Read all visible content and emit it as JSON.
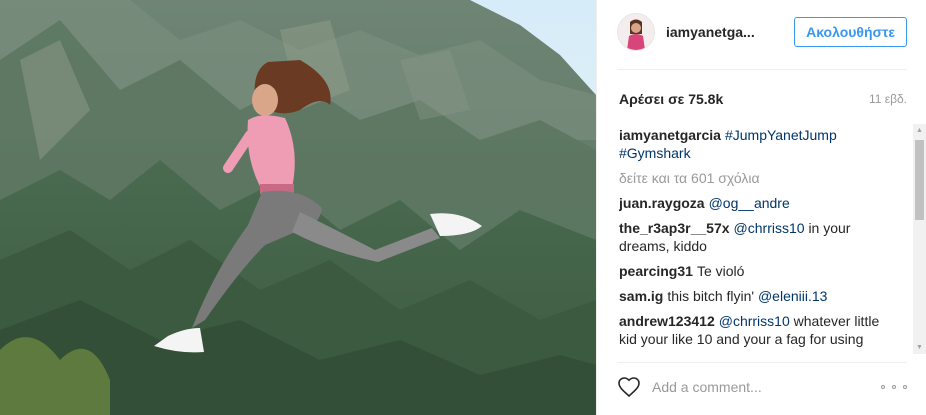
{
  "post": {
    "photo_icon": "post-photo",
    "colors": {
      "sky": "#dfeef8",
      "mountain": "#4c6a55",
      "accent": "#3897f0",
      "hashtag": "#003569",
      "muted": "#999999",
      "text": "#262626"
    }
  },
  "header": {
    "username": "iamyanetga...",
    "follow_label": "Ακολουθήστε"
  },
  "stats": {
    "likes": "Αρέσει σε 75.8k",
    "age": "11 εβδ."
  },
  "caption": {
    "user": "iamyanetgarcia",
    "tags": [
      "#JumpYanetJump",
      "#Gymshark"
    ]
  },
  "view_all": "δείτε και τα 601 σχόλια",
  "comments": [
    {
      "user": "juan.raygoza",
      "text": "",
      "tag": "@og__andre"
    },
    {
      "user": "the_r3ap3r__57x",
      "tag": "@chrriss10",
      "text": "in your dreams, kiddo"
    },
    {
      "user": "pearcing31",
      "tag": "",
      "text": "Te violó"
    },
    {
      "user": "sam.ig",
      "tag": "",
      "text": "this bitch flyin'",
      "tag_after": "@eleniii.13"
    },
    {
      "user": "andrew123412",
      "tag": "@chrriss10",
      "text": "whatever little kid your like 10 and your a fag for using"
    }
  ],
  "footer": {
    "placeholder": "Add a comment...",
    "like_icon": "heart-outline-icon",
    "more_icon": "more-options-icon"
  }
}
